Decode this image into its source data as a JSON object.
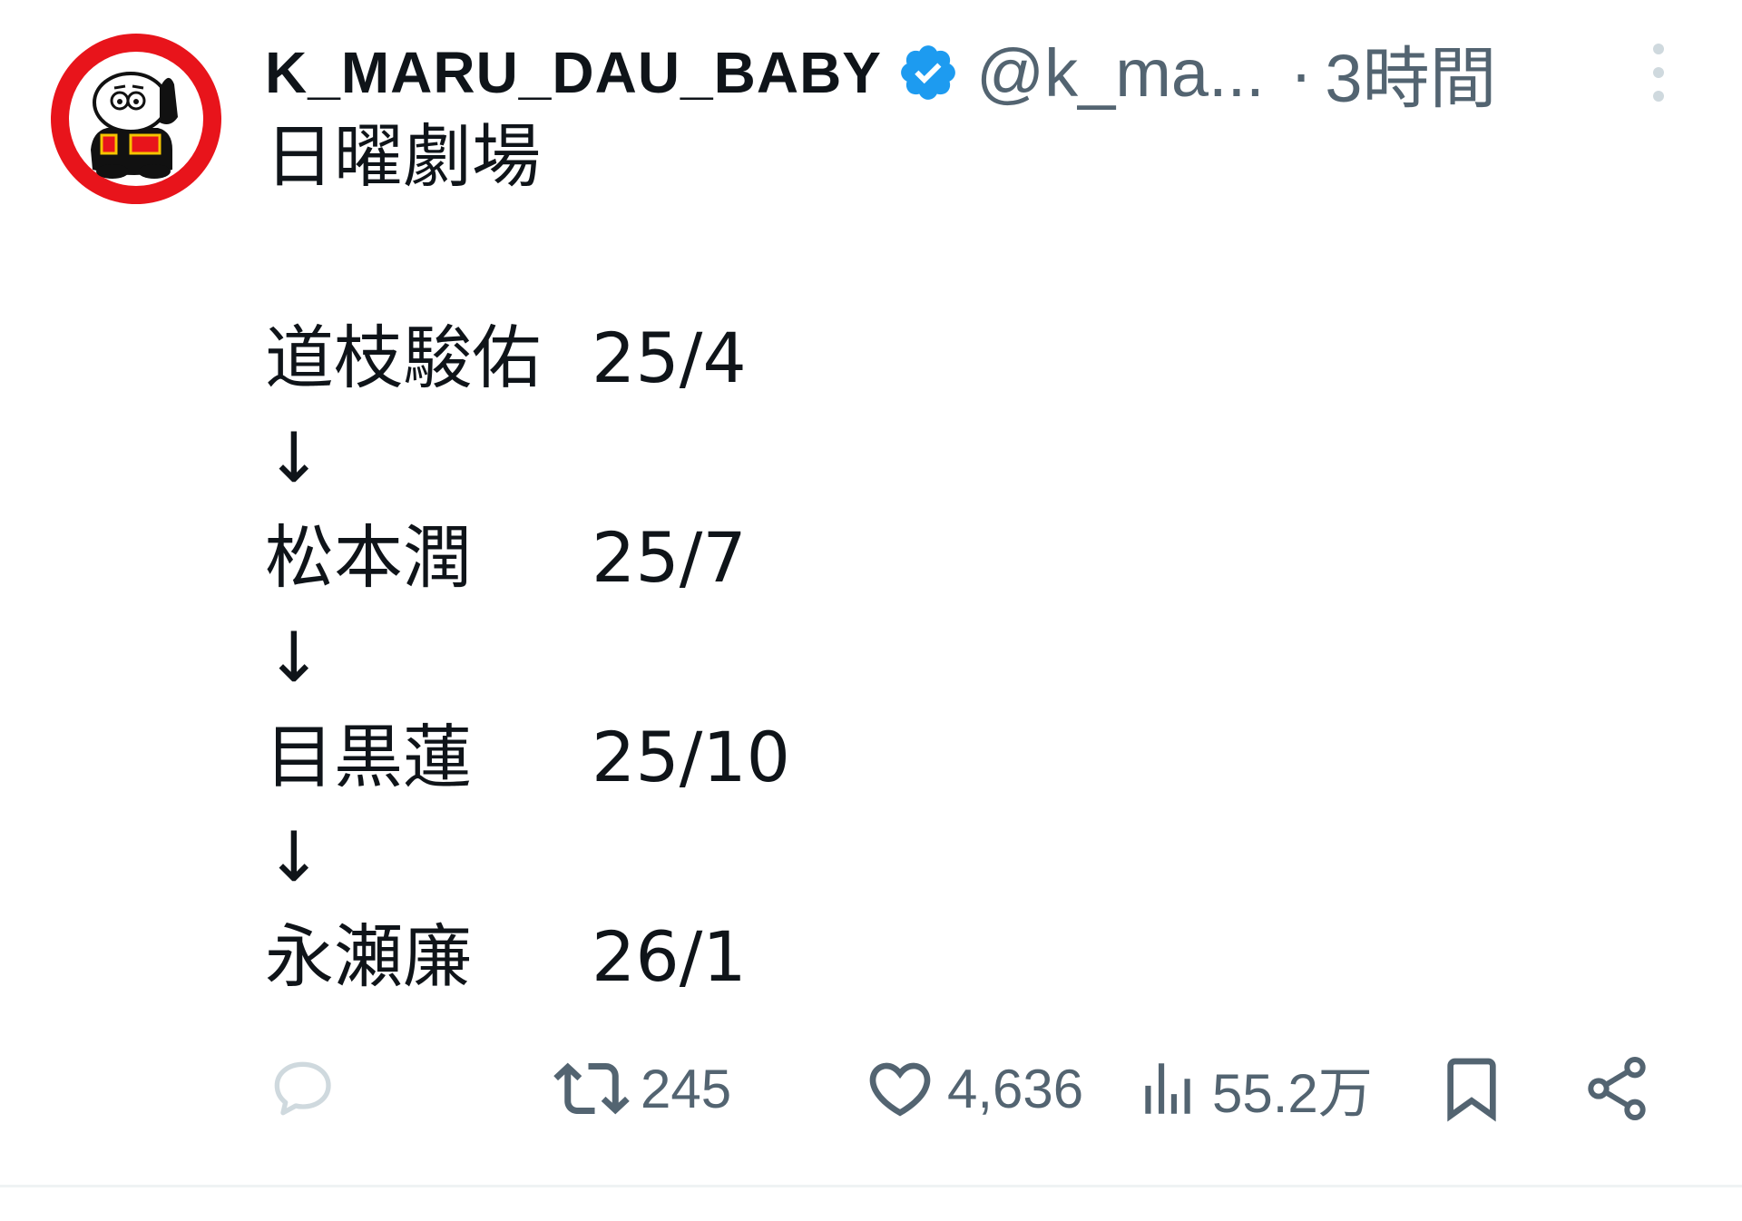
{
  "author": {
    "display_name": "K_MARU_DAU_BABY",
    "handle": "@k_ma...",
    "separator": "·",
    "time": "3時間",
    "verified_color": "#1d9bf0",
    "avatar_icon": "cartoon-mascot-avatar-icon"
  },
  "post": {
    "title": "日曜劇場",
    "entries": [
      {
        "name": "道枝駿佑",
        "date": "25/4"
      },
      {
        "name": "松本潤",
        "date": "25/7"
      },
      {
        "name": "目黒蓮",
        "date": "25/10"
      },
      {
        "name": "永瀬廉",
        "date": "26/1"
      }
    ],
    "arrow": "↓"
  },
  "actions": {
    "reply": {
      "icon": "reply-icon",
      "count": ""
    },
    "repost": {
      "icon": "repost-icon",
      "count": "245"
    },
    "like": {
      "icon": "heart-icon",
      "count": "4,636"
    },
    "views": {
      "icon": "views-icon",
      "count": "55.2万"
    },
    "bookmark": {
      "icon": "bookmark-icon"
    },
    "share": {
      "icon": "share-icon"
    }
  },
  "colors": {
    "text": "#0f1419",
    "secondary": "#536471",
    "divider": "#eff3f4"
  }
}
